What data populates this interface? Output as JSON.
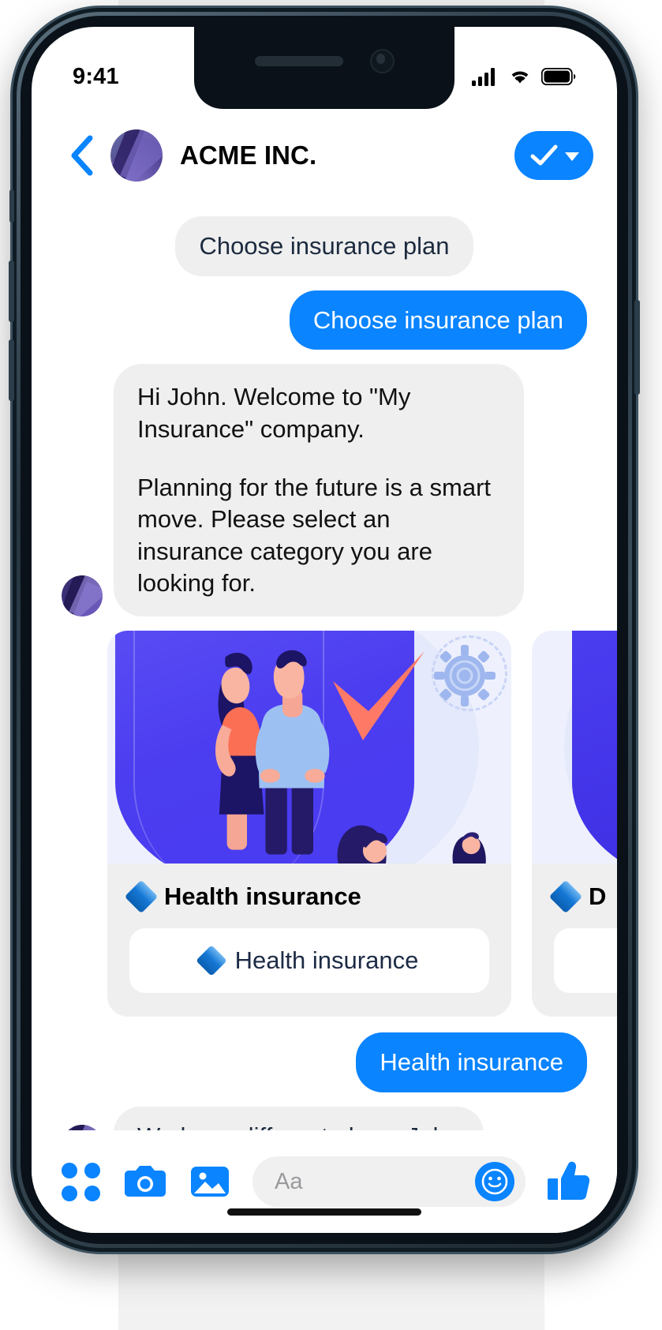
{
  "status_bar": {
    "time": "9:41",
    "cellular_icon": "signal-bars-icon",
    "wifi_icon": "wifi-icon",
    "battery_icon": "battery-full-icon"
  },
  "header": {
    "back_icon": "chevron-left-icon",
    "avatar": "acme-avatar",
    "title": "ACME INC.",
    "action_icon": "check-icon",
    "action_caret": "chevron-down-icon"
  },
  "messages": [
    {
      "id": "m1",
      "type": "bubble",
      "align": "center",
      "style": "grey",
      "text": "Choose insurance plan"
    },
    {
      "id": "m2",
      "type": "bubble",
      "align": "right",
      "style": "blue",
      "text": "Choose insurance plan"
    },
    {
      "id": "m3",
      "type": "bubble",
      "align": "left",
      "style": "grey",
      "paragraphs": [
        "Hi John. Welcome to \"My Insurance\" company.",
        "Planning for the future is a smart move. Please select an insurance category you are looking for."
      ]
    },
    {
      "id": "m4",
      "type": "carousel",
      "align": "left",
      "cards": [
        {
          "title": "Health insurance",
          "title_icon": "blue-diamond-icon",
          "button_label": "Health insurance",
          "button_icon": "blue-diamond-icon",
          "image_alt": "couple-shield-illustration"
        },
        {
          "title": "D",
          "title_icon": "blue-diamond-icon",
          "button_label": "",
          "button_icon": "blue-diamond-icon",
          "image_alt": "second-card-illustration"
        }
      ]
    },
    {
      "id": "m5",
      "type": "bubble",
      "align": "right",
      "style": "blue",
      "text": "Health insurance"
    },
    {
      "id": "m6",
      "type": "bubble",
      "align": "left",
      "style": "grey",
      "text": "We have different plans, John"
    }
  ],
  "composer": {
    "apps_icon": "grid-apps-icon",
    "camera_icon": "camera-icon",
    "gallery_icon": "photo-gallery-icon",
    "input_placeholder": "Aa",
    "input_value": "",
    "emoji_icon": "smiley-icon",
    "like_icon": "thumbs-up-icon"
  },
  "colors": {
    "accent_blue": "#0a84ff",
    "bubble_grey": "#efefef",
    "text_dark": "#1d2b45",
    "illustration_purple": "#4b3df0",
    "illustration_coral": "#ff7a66"
  }
}
